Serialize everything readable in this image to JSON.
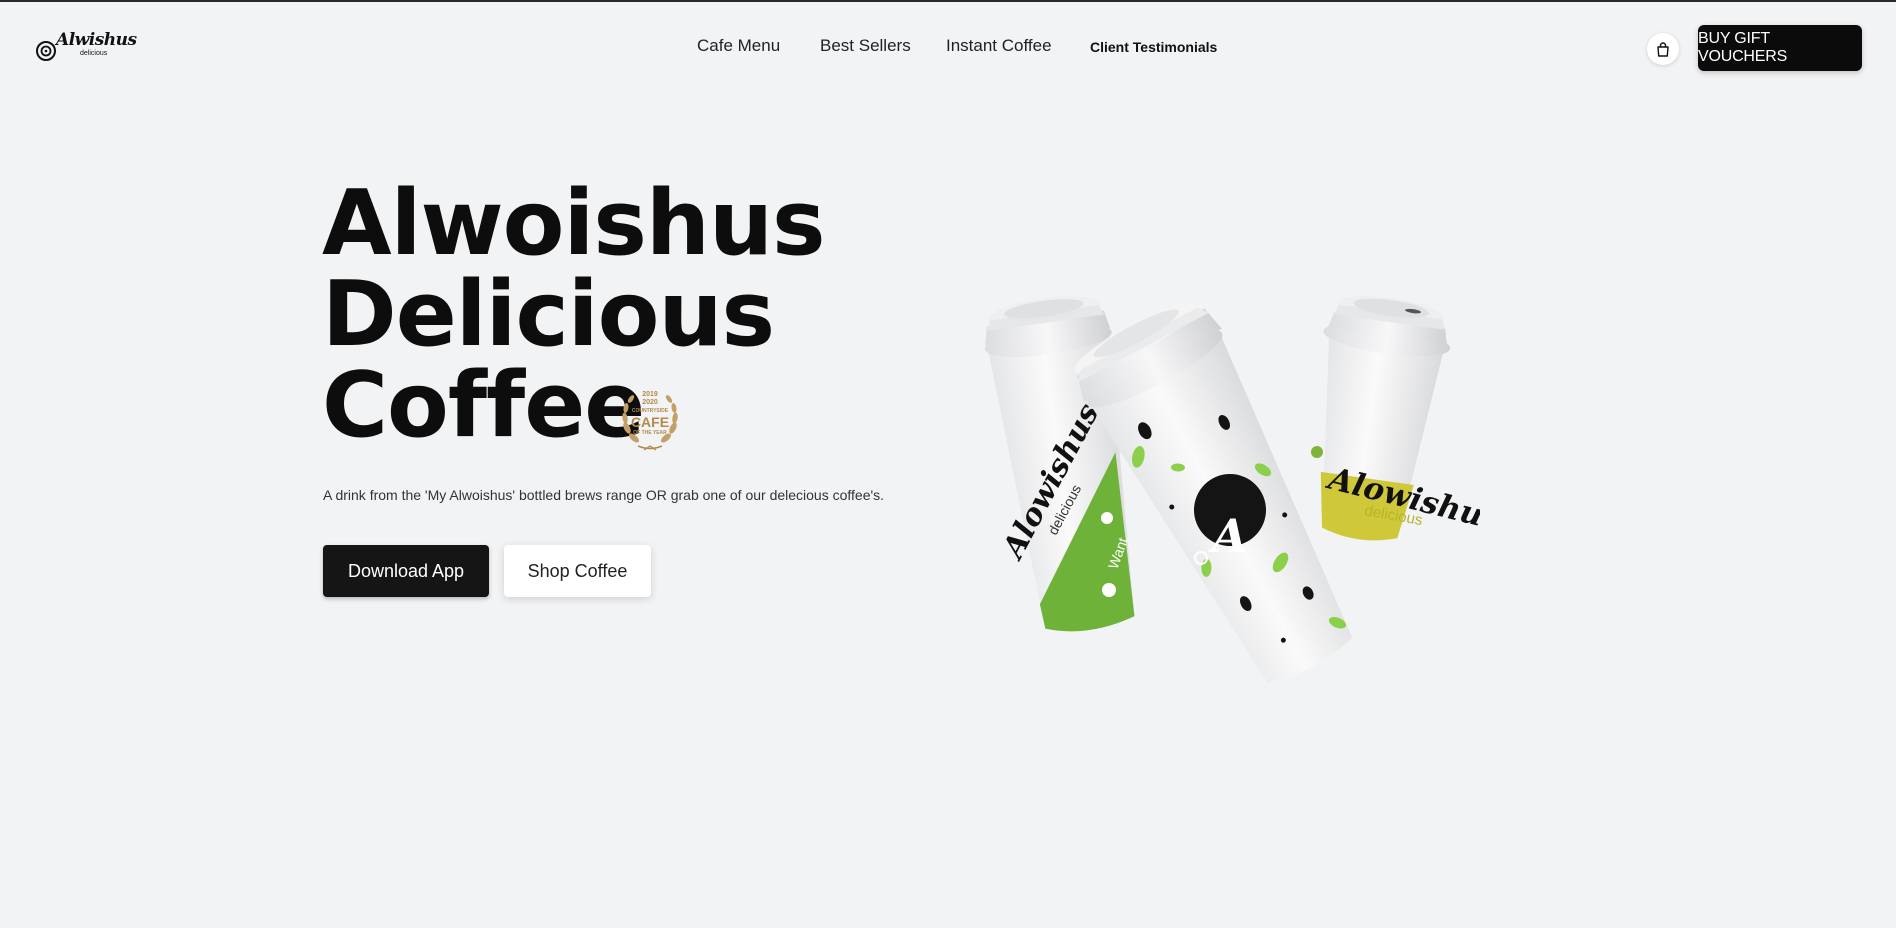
{
  "brand": {
    "logo_text": "Alwishus",
    "logo_sub": "delicious"
  },
  "nav": {
    "items": [
      {
        "label": "Cafe Menu"
      },
      {
        "label": "Best Sellers"
      },
      {
        "label": "Instant Coffee"
      },
      {
        "label": "Client Testimonials"
      }
    ]
  },
  "header": {
    "cart_icon": "shopping-bag-icon",
    "cta_label": "BUY GIFT VOUCHERS"
  },
  "hero": {
    "title_lines": [
      "Alwoishus",
      "Delicious",
      "Coffee"
    ],
    "award": {
      "years": "2019",
      "years2": "2020",
      "line1": "COUNTRYSIDE",
      "main": "CAFE",
      "line2": "OF THE YEAR"
    },
    "tagline": "A drink from the 'My Alwoishus' bottled brews range OR grab one of our delecious coffee's.",
    "primary_button": "Download App",
    "secondary_button": "Shop Coffee"
  },
  "product_image": {
    "left_cup_text": "Alowishus",
    "left_cup_sub": "delicious",
    "left_cup_side": "Want",
    "right_cup_text": "Alowishus",
    "right_cup_sub": "delicious",
    "center_cup_monogram": "A"
  },
  "colors": {
    "background": "#f2f3f5",
    "primary": "#0b0b0b",
    "green_accent": "#6fb23a",
    "yellow_accent": "#cfc93a",
    "award_gold": "#b38a4a"
  }
}
